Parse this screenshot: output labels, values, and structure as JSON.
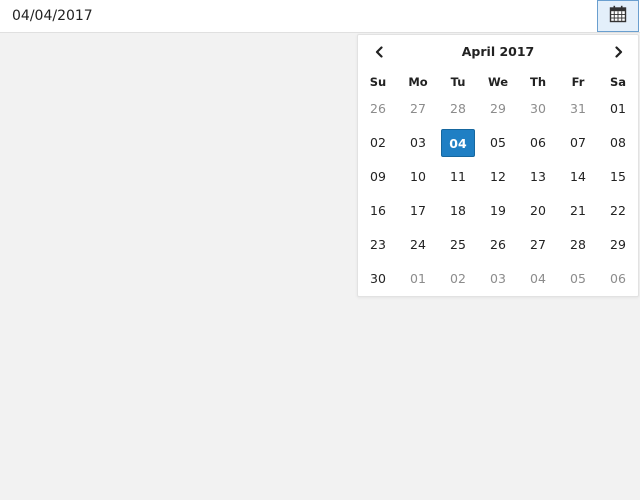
{
  "date_input": {
    "value": "04/04/2017"
  },
  "calendar_button": {
    "icon": "calendar-icon"
  },
  "datepicker": {
    "month_title": "April 2017",
    "prev_icon": "chevron-left-icon",
    "next_icon": "chevron-right-icon",
    "weekdays": [
      "Su",
      "Mo",
      "Tu",
      "We",
      "Th",
      "Fr",
      "Sa"
    ],
    "weeks": [
      [
        {
          "d": "26",
          "m": true
        },
        {
          "d": "27",
          "m": true
        },
        {
          "d": "28",
          "m": true
        },
        {
          "d": "29",
          "m": true
        },
        {
          "d": "30",
          "m": true
        },
        {
          "d": "31",
          "m": true
        },
        {
          "d": "01",
          "m": false
        }
      ],
      [
        {
          "d": "02",
          "m": false
        },
        {
          "d": "03",
          "m": false
        },
        {
          "d": "04",
          "m": false,
          "sel": true
        },
        {
          "d": "05",
          "m": false
        },
        {
          "d": "06",
          "m": false
        },
        {
          "d": "07",
          "m": false
        },
        {
          "d": "08",
          "m": false
        }
      ],
      [
        {
          "d": "09",
          "m": false
        },
        {
          "d": "10",
          "m": false
        },
        {
          "d": "11",
          "m": false
        },
        {
          "d": "12",
          "m": false
        },
        {
          "d": "13",
          "m": false
        },
        {
          "d": "14",
          "m": false
        },
        {
          "d": "15",
          "m": false
        }
      ],
      [
        {
          "d": "16",
          "m": false
        },
        {
          "d": "17",
          "m": false
        },
        {
          "d": "18",
          "m": false
        },
        {
          "d": "19",
          "m": false
        },
        {
          "d": "20",
          "m": false
        },
        {
          "d": "21",
          "m": false
        },
        {
          "d": "22",
          "m": false
        }
      ],
      [
        {
          "d": "23",
          "m": false
        },
        {
          "d": "24",
          "m": false
        },
        {
          "d": "25",
          "m": false
        },
        {
          "d": "26",
          "m": false
        },
        {
          "d": "27",
          "m": false
        },
        {
          "d": "28",
          "m": false
        },
        {
          "d": "29",
          "m": false
        }
      ],
      [
        {
          "d": "30",
          "m": false
        },
        {
          "d": "01",
          "m": true
        },
        {
          "d": "02",
          "m": true
        },
        {
          "d": "03",
          "m": true
        },
        {
          "d": "04",
          "m": true
        },
        {
          "d": "05",
          "m": true
        },
        {
          "d": "06",
          "m": true
        }
      ]
    ],
    "selected_color": "#1f7fc4"
  }
}
